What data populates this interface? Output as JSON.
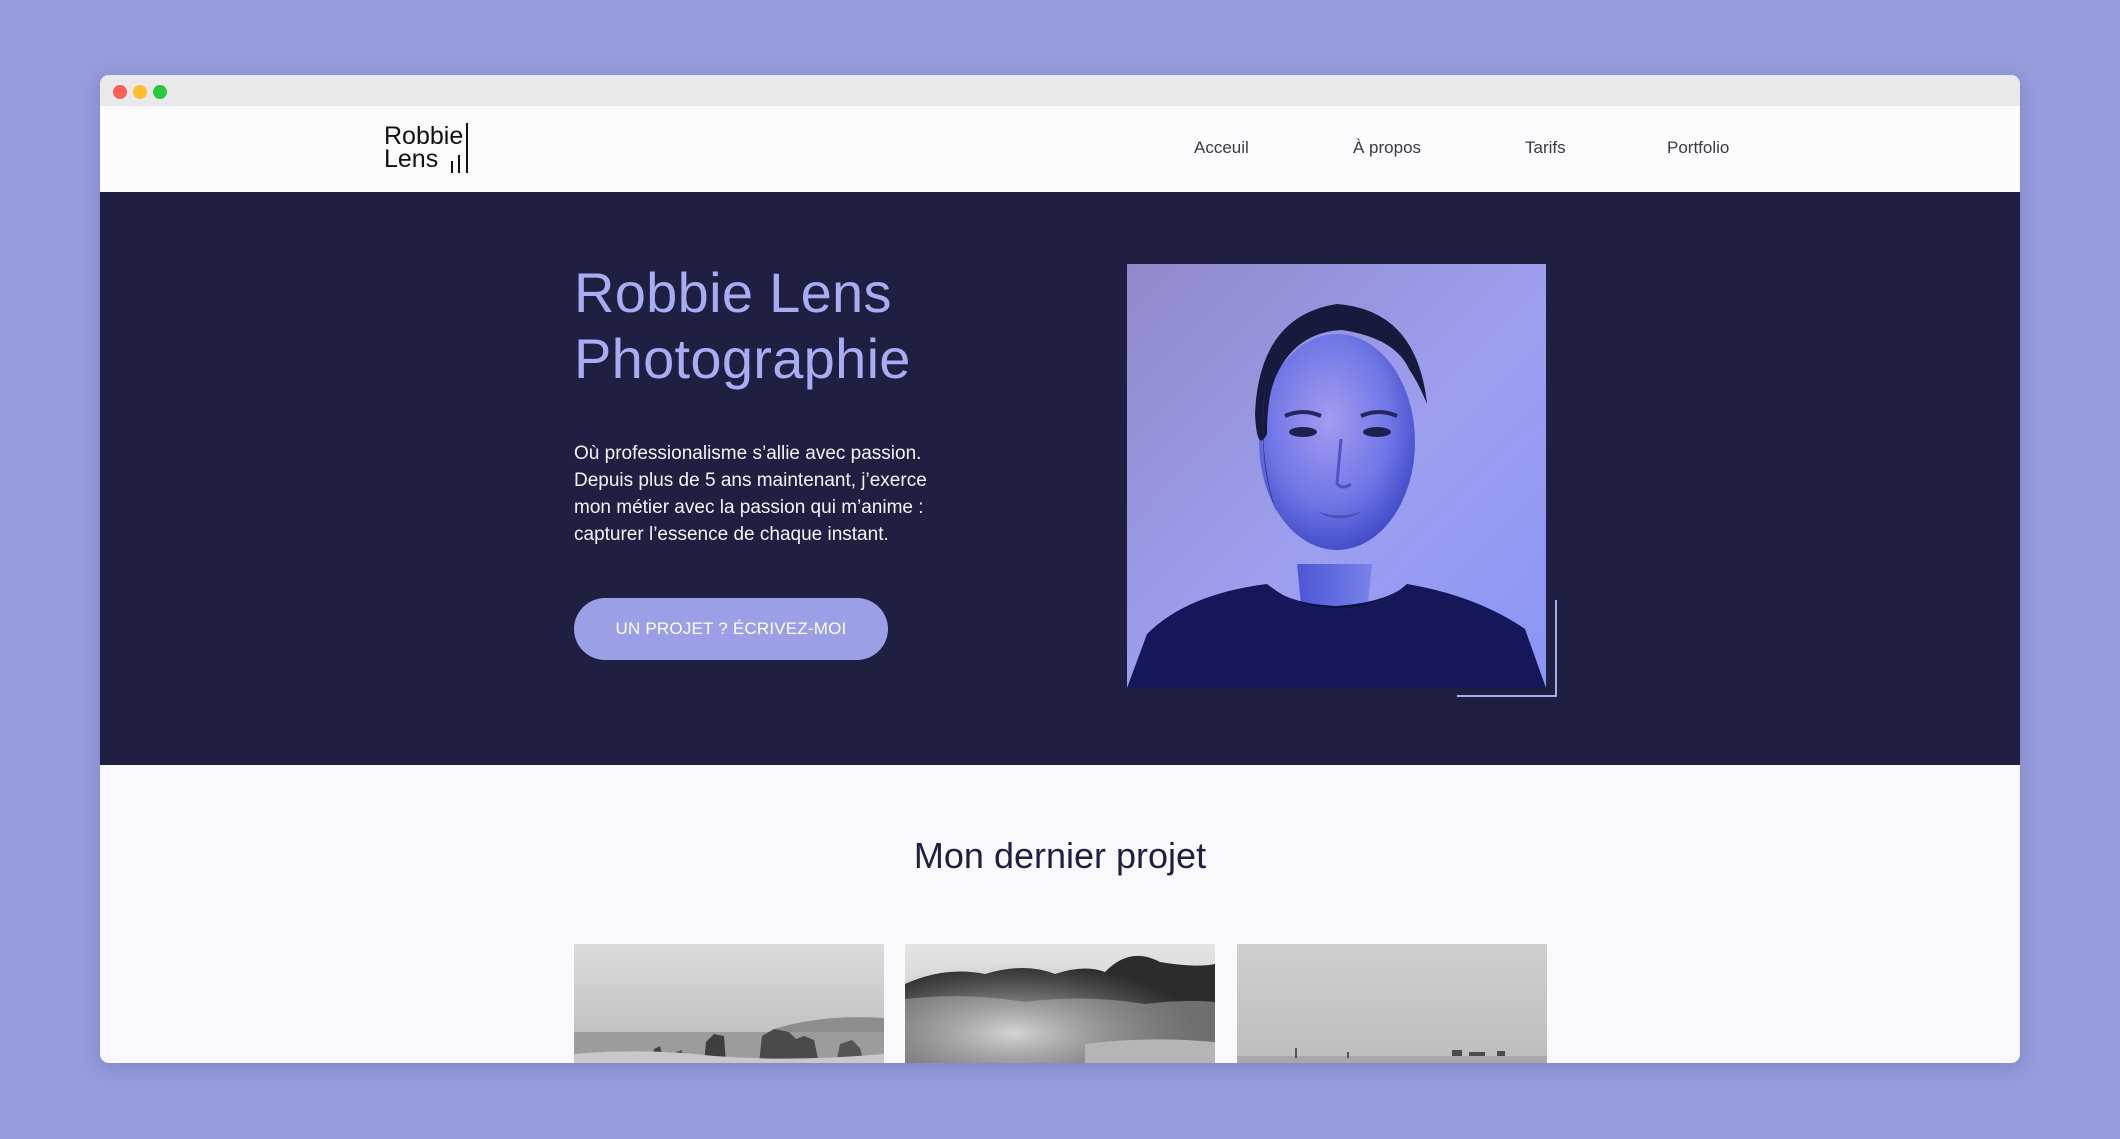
{
  "logo": {
    "line1": "Robbie",
    "line2": "Lens"
  },
  "nav": {
    "items": [
      {
        "label": "Acceuil"
      },
      {
        "label": "À propos"
      },
      {
        "label": "Tarifs"
      },
      {
        "label": "Portfolio"
      }
    ]
  },
  "hero": {
    "title_lines": [
      "Robbie Lens",
      "Photographie"
    ],
    "paragraph_lines": [
      "Où professionalisme s’allie avec passion.",
      "Depuis plus de 5 ans maintenant, j’exerce",
      "mon métier avec la passion qui m’anime :",
      "capturer l’essence de chaque instant."
    ],
    "cta_label": "UN PROJET ? ÉCRIVEZ-MOI"
  },
  "project": {
    "title": "Mon dernier projet"
  },
  "colors": {
    "page_background": "#959bdb",
    "hero_background": "#1f2041",
    "accent": "#a7adf3",
    "button": "#9a9fe6"
  }
}
